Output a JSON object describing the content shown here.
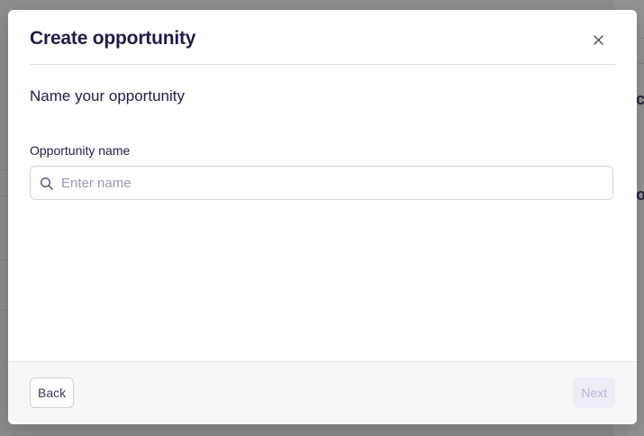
{
  "modal": {
    "title": "Create opportunity",
    "section_heading": "Name your opportunity",
    "close_icon": "close-icon"
  },
  "form": {
    "field_label": "Opportunity name",
    "name_input": {
      "value": "",
      "placeholder": "Enter name",
      "icon": "search-icon"
    }
  },
  "footer": {
    "back_label": "Back",
    "next_label": "Next",
    "next_disabled": true
  },
  "colors": {
    "title_text": "#1f1d4a",
    "placeholder_text": "#9a9ab3",
    "next_disabled_text": "#b4b4d8",
    "next_disabled_bg": "#ededf5"
  }
}
